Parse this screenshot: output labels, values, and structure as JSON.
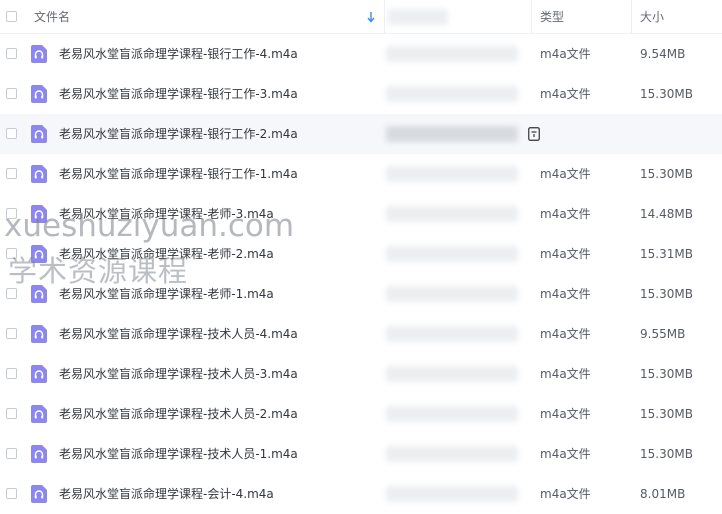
{
  "header": {
    "name_label": "文件名",
    "type_label": "类型",
    "size_label": "大小"
  },
  "files": [
    {
      "name": "老易风水堂盲派命理学课程-银行工作-4.m4a",
      "type": "m4a文件",
      "size": "9.54MB"
    },
    {
      "name": "老易风水堂盲派命理学课程-银行工作-3.m4a",
      "type": "m4a文件",
      "size": "15.30MB"
    },
    {
      "name": "老易风水堂盲派命理学课程-银行工作-2.m4a",
      "type": "",
      "size": ""
    },
    {
      "name": "老易风水堂盲派命理学课程-银行工作-1.m4a",
      "type": "m4a文件",
      "size": "15.30MB"
    },
    {
      "name": "老易风水堂盲派命理学课程-老师-3.m4a",
      "type": "m4a文件",
      "size": "14.48MB"
    },
    {
      "name": "老易风水堂盲派命理学课程-老师-2.m4a",
      "type": "m4a文件",
      "size": "15.31MB"
    },
    {
      "name": "老易风水堂盲派命理学课程-老师-1.m4a",
      "type": "m4a文件",
      "size": "15.30MB"
    },
    {
      "name": "老易风水堂盲派命理学课程-技术人员-4.m4a",
      "type": "m4a文件",
      "size": "9.55MB"
    },
    {
      "name": "老易风水堂盲派命理学课程-技术人员-3.m4a",
      "type": "m4a文件",
      "size": "15.30MB"
    },
    {
      "name": "老易风水堂盲派命理学课程-技术人员-2.m4a",
      "type": "m4a文件",
      "size": "15.30MB"
    },
    {
      "name": "老易风水堂盲派命理学课程-技术人员-1.m4a",
      "type": "m4a文件",
      "size": "15.30MB"
    },
    {
      "name": "老易风水堂盲派命理学课程-会计-4.m4a",
      "type": "m4a文件",
      "size": "8.01MB"
    }
  ],
  "watermark": {
    "line1": "xueshuziyuan.com",
    "line2": "学术资源课程"
  },
  "colors": {
    "icon_bg": "#8c86f0",
    "accent": "#3a8ee6",
    "row_hover": "#f5f7fb"
  },
  "icons": {
    "file": "headphones-audio-icon",
    "sort": "sort-down-arrow-icon",
    "more": "more-actions-icon"
  }
}
